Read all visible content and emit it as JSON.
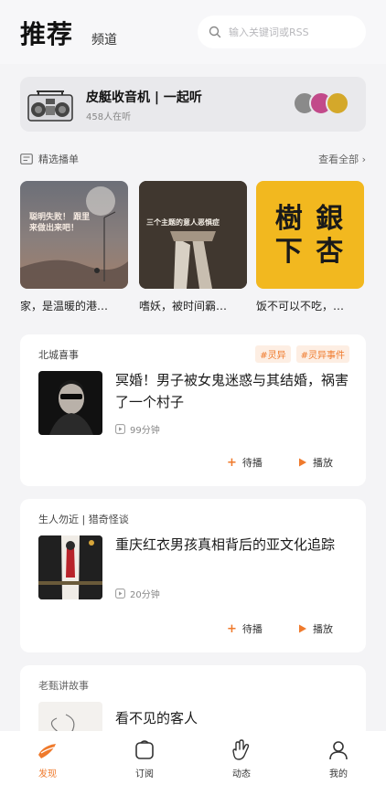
{
  "header": {
    "title": "推荐",
    "subtitle": "频道",
    "search_placeholder": "输入关键词或RSS"
  },
  "radio": {
    "title": "皮艇收音机 | 一起听",
    "listeners": "458人在听"
  },
  "playlists_section": {
    "title": "精选播单",
    "view_all": "查看全部 ›"
  },
  "playlists": [
    {
      "caption": "家，是温暖的港…",
      "cover_text": "聪明失败！ 跟里来做出来吧！"
    },
    {
      "caption": "嗜妖，被时间霸…",
      "cover_text": "三个主题的意人恶惧症"
    },
    {
      "caption": "饭不可以不吃，…",
      "cover_text": "樹 銀 下 杏"
    }
  ],
  "episodes": [
    {
      "source": "北城喜事",
      "tags": [
        "#灵异",
        "#灵异事件"
      ],
      "title": "冥婚！男子被女鬼迷惑与其结婚，祸害了一个村子",
      "duration": "99分钟",
      "later_label": "待播",
      "play_label": "播放"
    },
    {
      "source": "生人勿近 | 猎奇怪谈",
      "tags": [],
      "title": "重庆红衣男孩真相背后的亚文化追踪",
      "duration": "20分钟",
      "later_label": "待播",
      "play_label": "播放"
    },
    {
      "source": "老甄讲故事",
      "tags": [],
      "title": "看不见的客人",
      "duration": "",
      "later_label": "",
      "play_label": ""
    }
  ],
  "tabbar": {
    "items": [
      {
        "label": "发现",
        "icon": "discover-icon",
        "active": true
      },
      {
        "label": "订阅",
        "icon": "subscribe-icon",
        "active": false
      },
      {
        "label": "动态",
        "icon": "activity-icon",
        "active": false
      },
      {
        "label": "我的",
        "icon": "profile-icon",
        "active": false
      }
    ]
  },
  "colors": {
    "accent": "#ef7a2c",
    "tag_bg": "#fdeee3",
    "page_bg": "#f4f4f6"
  }
}
